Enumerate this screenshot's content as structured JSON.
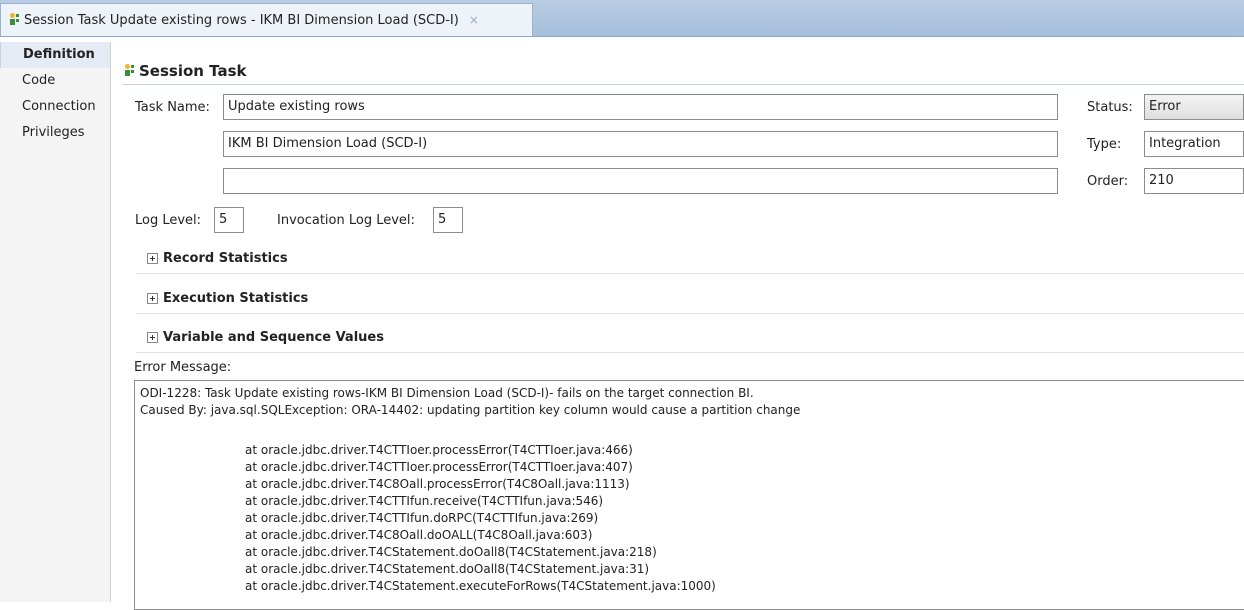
{
  "tab": {
    "title": "Session Task Update existing rows - IKM BI Dimension Load (SCD-I)",
    "close_glyph": "×"
  },
  "nav": {
    "items": [
      "Definition",
      "Code",
      "Connection",
      "Privileges"
    ],
    "active": "Definition"
  },
  "section": {
    "title": "Session Task"
  },
  "form": {
    "task_name_label": "Task Name:",
    "task_name_value": "Update existing rows",
    "km_value": "IKM BI Dimension Load (SCD-I)",
    "extra_value": "",
    "status_label": "Status:",
    "status_value": "Error",
    "type_label": "Type:",
    "type_value": "Integration",
    "order_label": "Order:",
    "order_value": "210",
    "log_level_label": "Log Level:",
    "log_level_value": "5",
    "invocation_log_level_label": "Invocation Log Level:",
    "invocation_log_level_value": "5"
  },
  "sections": [
    "Record Statistics",
    "Execution Statistics",
    "Variable and Sequence Values"
  ],
  "error": {
    "label": "Error Message:",
    "line1": "ODI-1228: Task Update existing rows-IKM BI Dimension Load (SCD-I)- fails on the target connection BI.",
    "line2": "Caused By: java.sql.SQLException: ORA-14402: updating partition key column would cause a partition change",
    "stack": [
      "at oracle.jdbc.driver.T4CTTIoer.processError(T4CTTIoer.java:466)",
      "at oracle.jdbc.driver.T4CTTIoer.processError(T4CTTIoer.java:407)",
      "at oracle.jdbc.driver.T4C8Oall.processError(T4C8Oall.java:1113)",
      "at oracle.jdbc.driver.T4CTTIfun.receive(T4CTTIfun.java:546)",
      "at oracle.jdbc.driver.T4CTTIfun.doRPC(T4CTTIfun.java:269)",
      "at oracle.jdbc.driver.T4C8Oall.doOALL(T4C8Oall.java:603)",
      "at oracle.jdbc.driver.T4CStatement.doOall8(T4CStatement.java:218)",
      "at oracle.jdbc.driver.T4CStatement.doOall8(T4CStatement.java:31)",
      "at oracle.jdbc.driver.T4CStatement.executeForRows(T4CStatement.java:1000)"
    ]
  },
  "icons": {
    "task": "session-task-icon",
    "expand": "plus-box-icon"
  }
}
